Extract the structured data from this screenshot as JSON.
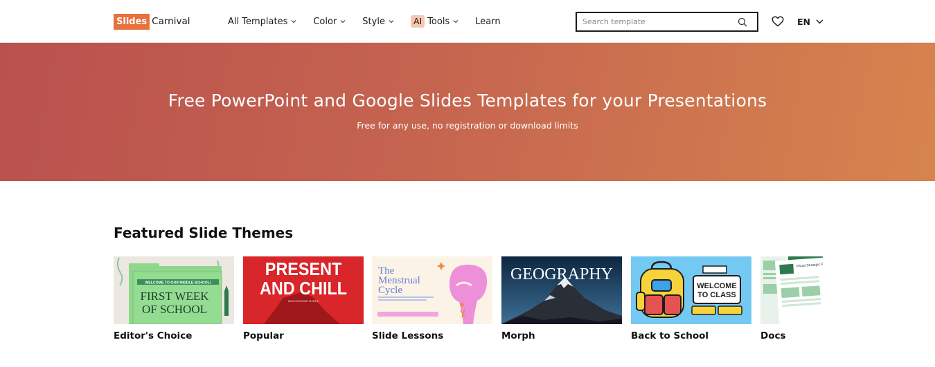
{
  "header": {
    "logo": {
      "part1": "Slides",
      "part2": "Carnival"
    },
    "nav": [
      {
        "label": "All Templates",
        "has_dropdown": true
      },
      {
        "label": "Color",
        "has_dropdown": true
      },
      {
        "label": "Style",
        "has_dropdown": true
      },
      {
        "badge": "AI",
        "label": "Tools",
        "has_dropdown": true
      },
      {
        "label": "Learn",
        "has_dropdown": false
      }
    ],
    "search": {
      "placeholder": "Search template",
      "value": "",
      "icon": "search-icon"
    },
    "favorites_icon": "heart-icon",
    "language": {
      "value": "EN",
      "icon": "chevron-down-icon"
    }
  },
  "hero": {
    "title": "Free PowerPoint and Google Slides Templates for your Presentations",
    "subtitle": "Free for any use, no registration or download limits"
  },
  "featured": {
    "title": "Featured Slide Themes",
    "cards": [
      {
        "label": "Editor's Choice",
        "thumb": {
          "banner": "WELCOME TO OUR MIDDLE SCHOOL!",
          "title_line1": "FIRST WEEK",
          "title_line2": "OF SCHOOL"
        }
      },
      {
        "label": "Popular",
        "thumb": {
          "title_line1": "PRESENT",
          "title_line2": "AND CHILL",
          "small": "BACKGROUND SLIDES"
        }
      },
      {
        "label": "Slide Lessons",
        "thumb": {
          "title_line1": "The",
          "title_line2": "Menstrual",
          "title_line3": "Cycle"
        }
      },
      {
        "label": "Morph",
        "thumb": {
          "title": "GEOGRAPHY"
        }
      },
      {
        "label": "Back to School",
        "thumb": {
          "title_line1": "WELCOME",
          "title_line2": "TO CLASS"
        }
      },
      {
        "label": "Docs",
        "thumb": {
          "title": "Visual Strategic Plan"
        }
      }
    ]
  },
  "colors": {
    "brand_orange": "#e8713c",
    "hero_start": "#b9514e",
    "hero_end": "#d6844e",
    "ai_badge": "#f6c6ae"
  }
}
